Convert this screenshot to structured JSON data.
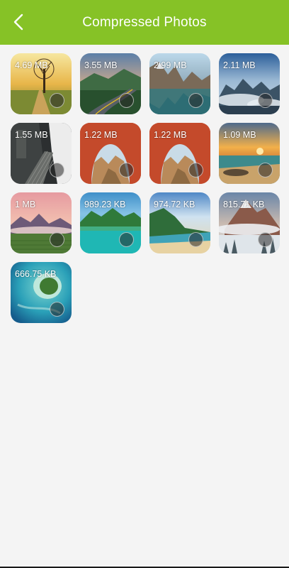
{
  "header": {
    "title": "Compressed Photos",
    "background_color": "#86c226",
    "back_icon": "chevron-left-icon"
  },
  "photos": [
    {
      "size": "4.69 MB",
      "scene": "sunset-tree-path"
    },
    {
      "size": "3.55 MB",
      "scene": "mountain-road"
    },
    {
      "size": "2.99 MB",
      "scene": "mountain-lake"
    },
    {
      "size": "2.11 MB",
      "scene": "misty-mountains"
    },
    {
      "size": "1.55 MB",
      "scene": "cliff-walkway"
    },
    {
      "size": "1.22 MB",
      "scene": "red-canyon-arch"
    },
    {
      "size": "1.22 MB",
      "scene": "red-canyon-arch"
    },
    {
      "size": "1.09 MB",
      "scene": "sunset-beach"
    },
    {
      "size": "1 MB",
      "scene": "pink-sky-valley"
    },
    {
      "size": "989.23 KB",
      "scene": "turquoise-lake"
    },
    {
      "size": "974.72 KB",
      "scene": "tropical-coast"
    },
    {
      "size": "815.71 KB",
      "scene": "snowy-mountain"
    },
    {
      "size": "666.75 KB",
      "scene": "aerial-island"
    }
  ]
}
